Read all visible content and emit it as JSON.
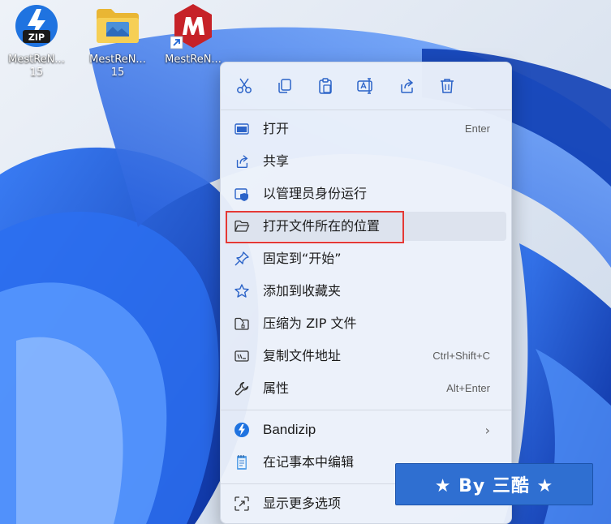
{
  "desktop": {
    "icons": [
      {
        "label": "MestReN...",
        "label_line2": "15",
        "icon": "bandizip-zip-icon"
      },
      {
        "label": "MestReN...",
        "label_line2": "15",
        "icon": "folder-icon"
      },
      {
        "label": "MestReN...",
        "label_line2": "",
        "icon": "mestrenova-shortcut-icon"
      }
    ]
  },
  "context_menu": {
    "toolbar": [
      {
        "name": "cut",
        "icon": "scissors-icon"
      },
      {
        "name": "copy",
        "icon": "copy-icon"
      },
      {
        "name": "paste",
        "icon": "clipboard-icon"
      },
      {
        "name": "rename",
        "icon": "rename-icon"
      },
      {
        "name": "share",
        "icon": "share-icon"
      },
      {
        "name": "delete",
        "icon": "trash-icon"
      }
    ],
    "items": [
      {
        "label": "打开",
        "shortcut": "Enter",
        "icon": "open-window-icon"
      },
      {
        "label": "共享",
        "shortcut": "",
        "icon": "share-icon"
      },
      {
        "label": "以管理员身份运行",
        "shortcut": "",
        "icon": "shield-icon"
      },
      {
        "label": "打开文件所在的位置",
        "shortcut": "",
        "icon": "folder-open-icon",
        "highlighted": true
      },
      {
        "label": "固定到“开始”",
        "shortcut": "",
        "icon": "pin-icon"
      },
      {
        "label": "添加到收藏夹",
        "shortcut": "",
        "icon": "star-icon"
      },
      {
        "label": "压缩为 ZIP 文件",
        "shortcut": "",
        "icon": "zip-folder-icon"
      },
      {
        "label": "复制文件地址",
        "shortcut": "Ctrl+Shift+C",
        "icon": "copy-path-icon"
      },
      {
        "label": "属性",
        "shortcut": "Alt+Enter",
        "icon": "wrench-icon"
      }
    ],
    "extra_items": [
      {
        "label": "Bandizip",
        "submenu": "›",
        "icon": "bandizip-icon"
      },
      {
        "label": "在记事本中编辑",
        "icon": "notepad-icon"
      }
    ],
    "more": {
      "label": "显示更多选项",
      "icon": "more-options-icon"
    }
  },
  "watermark": {
    "text": "★ By 三酷 ★"
  },
  "colors": {
    "accent_blue": "#2f6fd1",
    "highlight_red": "#e53935",
    "menu_bg": "#ecf1fa",
    "icon_blue": "#2b63c8"
  }
}
